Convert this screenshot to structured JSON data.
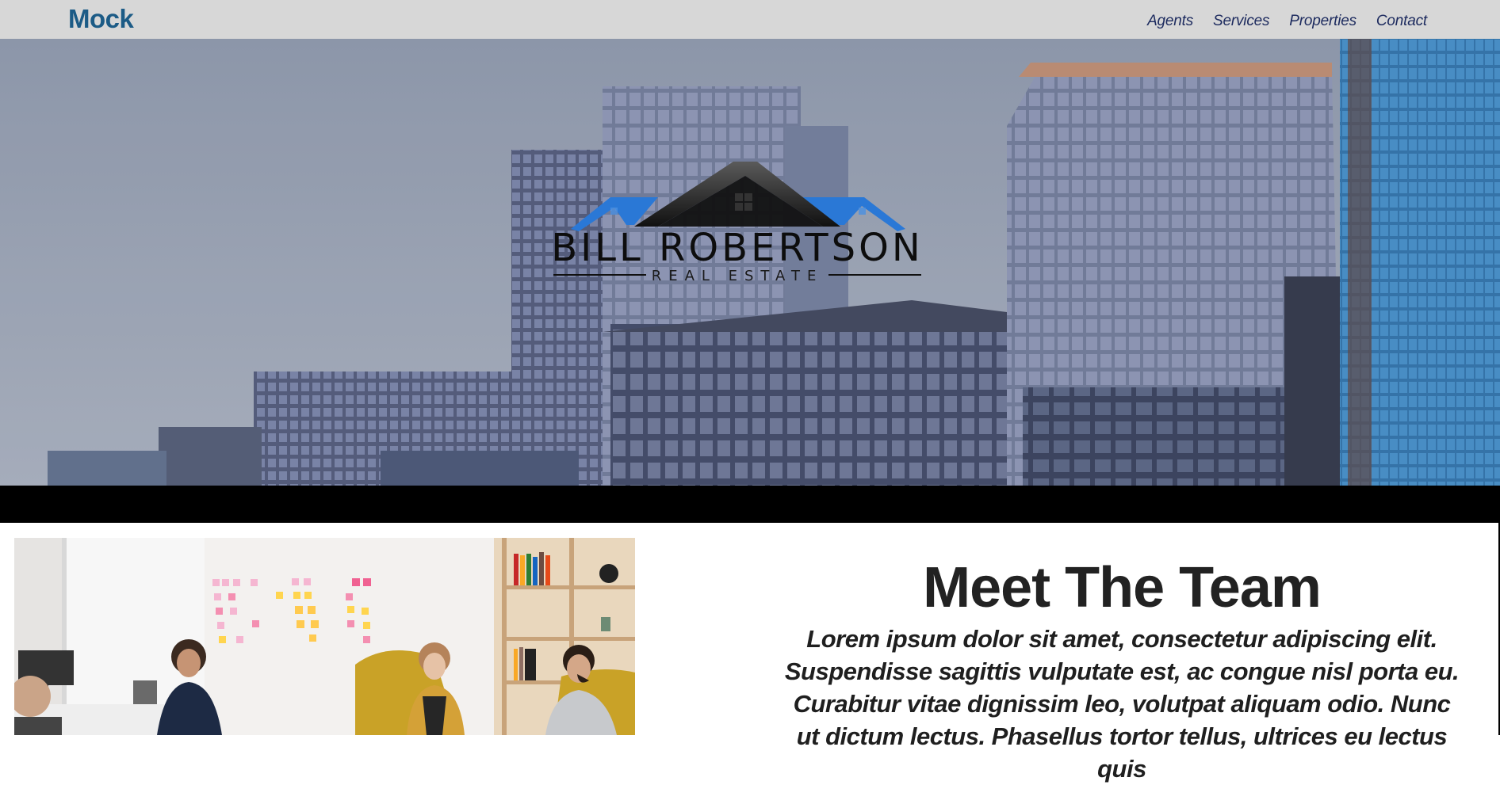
{
  "nav": {
    "brand": "Mock",
    "links": [
      "Agents",
      "Services",
      "Properties",
      "Contact"
    ]
  },
  "hero": {
    "logo_name": "BILL ROBERTSON",
    "logo_tagline": "REAL ESTATE",
    "background": "city-skyscrapers-photo"
  },
  "team": {
    "heading": "Meet The Team",
    "text": "Lorem ipsum dolor sit amet, consectetur adipiscing elit. Suspendisse sagittis vulputate est, ac congue nisl porta eu. Curabitur vitae dignissim leo, volutpat aliquam odio. Nunc ut dictum lectus. Phasellus tortor tellus, ultrices eu lectus quis",
    "photo": "team-meeting-photo"
  },
  "colors": {
    "navbar_bg": "#d7d7d7",
    "brand": "#1c5b86",
    "nav_link": "#1c2a5e",
    "logo_blue": "#2a78d6",
    "band": "#000000"
  }
}
